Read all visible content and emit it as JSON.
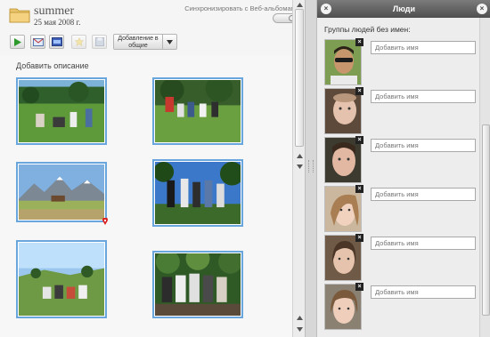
{
  "album": {
    "title": "summer",
    "date": "25 мая 2008 г.",
    "sync_label": "Синхронизировать с Веб-альбомами"
  },
  "toolbar": {
    "add_general_label": "Добавление в общие",
    "buttons": [
      "play-icon",
      "email-icon",
      "web-icon",
      "star-icon",
      "save-icon",
      "chevron-down-icon"
    ]
  },
  "content": {
    "add_description": "Добавить описание"
  },
  "people": {
    "title": "Люди",
    "groups_label": "Группы людей без имен:",
    "add_name_placeholder": "Добавить имя",
    "faces": [
      {
        "input": "Добавить имя"
      },
      {
        "input": "Добавить имя"
      },
      {
        "input": "Добавить имя"
      },
      {
        "input": "Добавить имя"
      },
      {
        "input": "Добавить имя"
      },
      {
        "input": "Добавить имя"
      }
    ]
  },
  "colors": {
    "photo_border": "#6aa6de",
    "header_dark": "#5a5a5a",
    "play_green": "#2e9a2e"
  }
}
